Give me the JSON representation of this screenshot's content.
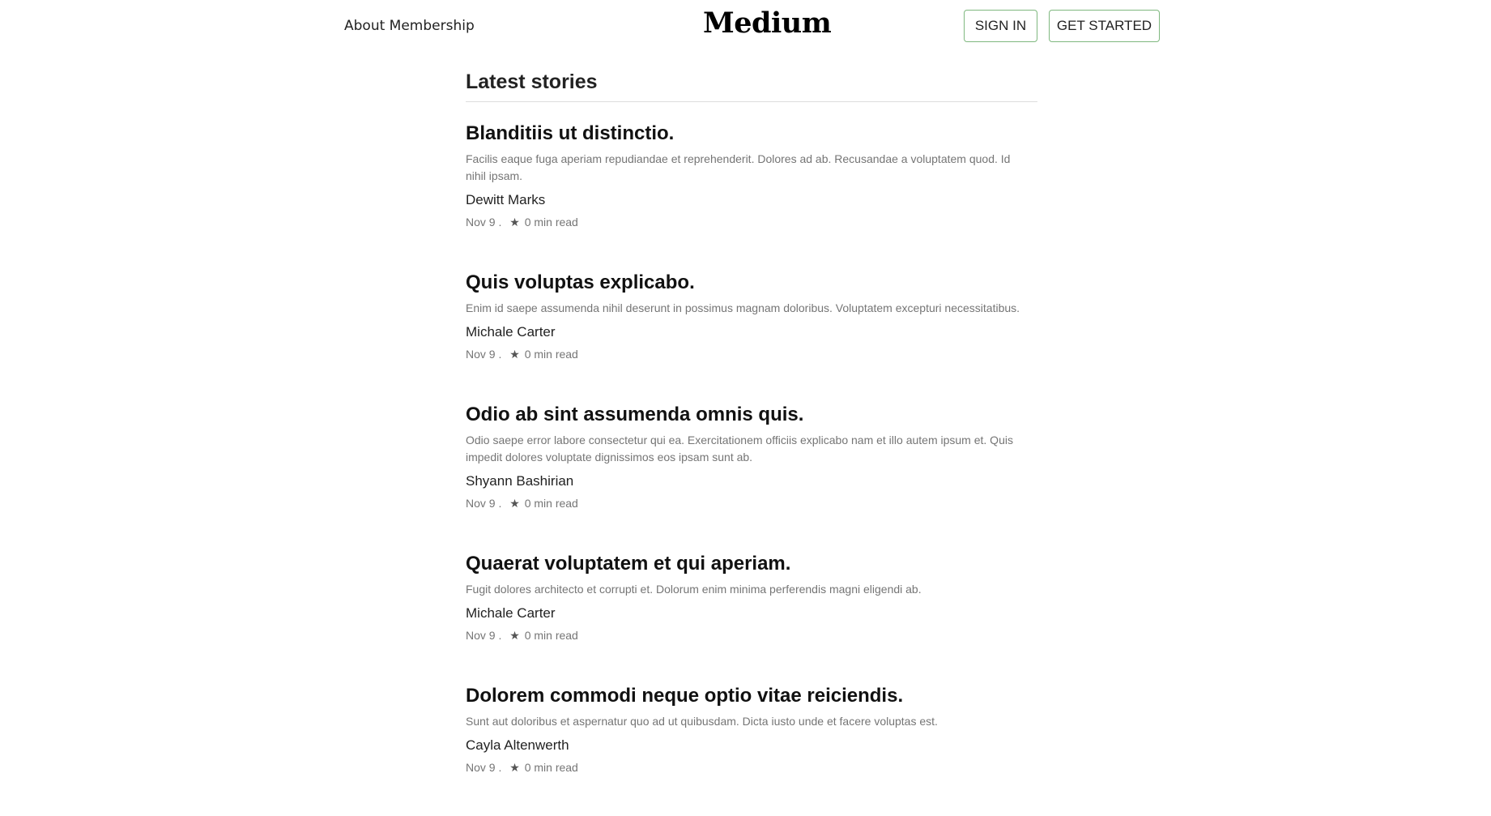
{
  "header": {
    "about_label": "About Membership",
    "logo_text": "Medium",
    "signin_label": "SIGN IN",
    "getstarted_label": "GET STARTED"
  },
  "main": {
    "section_title": "Latest stories",
    "stories": [
      {
        "title": "Blanditiis ut distinctio.",
        "excerpt": "Facilis eaque fuga aperiam repudiandae et reprehenderit. Dolores ad ab. Recusandae a voluptatem quod. Id nihil ipsam.",
        "author": "Dewitt Marks",
        "date": "Nov 9 .",
        "star": "★",
        "read_time": "0 min read"
      },
      {
        "title": "Quis voluptas explicabo.",
        "excerpt": "Enim id saepe assumenda nihil deserunt in possimus magnam doloribus. Voluptatem excepturi necessitatibus.",
        "author": "Michale Carter",
        "date": "Nov 9 .",
        "star": "★",
        "read_time": "0 min read"
      },
      {
        "title": "Odio ab sint assumenda omnis quis.",
        "excerpt": "Odio saepe error labore consectetur qui ea. Exercitationem officiis explicabo nam et illo autem ipsum et. Quis impedit dolores voluptate dignissimos eos ipsam sunt ab.",
        "author": "Shyann Bashirian",
        "date": "Nov 9 .",
        "star": "★",
        "read_time": "0 min read"
      },
      {
        "title": "Quaerat voluptatem et qui aperiam.",
        "excerpt": "Fugit dolores architecto et corrupti et. Dolorum enim minima perferendis magni eligendi ab.",
        "author": "Michale Carter",
        "date": "Nov 9 .",
        "star": "★",
        "read_time": "0 min read"
      },
      {
        "title": "Dolorem commodi neque optio vitae reiciendis.",
        "excerpt": "Sunt aut doloribus et aspernatur quo ad ut quibusdam. Dicta iusto unde et facere voluptas est.",
        "author": "Cayla Altenwerth",
        "date": "Nov 9 .",
        "star": "★",
        "read_time": "0 min read"
      }
    ]
  },
  "colors": {
    "button_border": "#7fb87f",
    "excerpt_text": "#757575"
  }
}
